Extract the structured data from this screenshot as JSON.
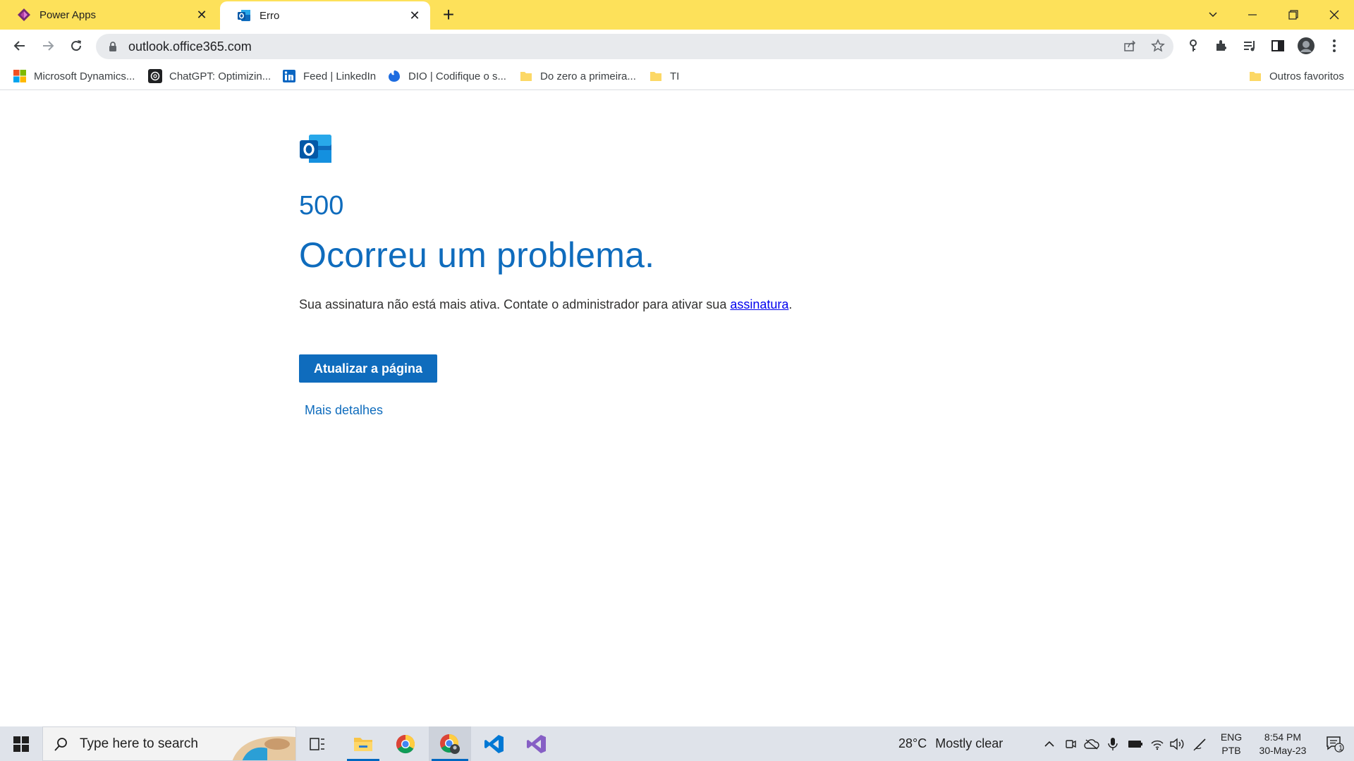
{
  "browser": {
    "tabs": [
      {
        "title": "Power Apps",
        "active": false
      },
      {
        "title": "Erro",
        "active": true
      }
    ],
    "url": "outlook.office365.com"
  },
  "bookmarks": [
    {
      "label": "Microsoft Dynamics...",
      "icon": "microsoft-icon"
    },
    {
      "label": "ChatGPT: Optimizin...",
      "icon": "chatgpt-icon"
    },
    {
      "label": "Feed | LinkedIn",
      "icon": "linkedin-icon"
    },
    {
      "label": "DIO | Codifique o s...",
      "icon": "dio-icon"
    },
    {
      "label": "Do zero a primeira...",
      "icon": "folder-icon"
    },
    {
      "label": "TI",
      "icon": "folder-icon"
    }
  ],
  "other_bookmarks": "Outros favoritos",
  "error": {
    "code": "500",
    "headline": "Ocorreu um problema.",
    "message_prefix": "Sua assinatura não está mais ativa. Contate o administrador para ativar sua ",
    "message_link": "assinatura",
    "message_suffix": ".",
    "refresh_button": "Atualizar a página",
    "details_link": "Mais detalhes"
  },
  "taskbar": {
    "search_placeholder": "Type here to search",
    "weather_temp": "28°C",
    "weather_text": "Mostly clear",
    "lang_top": "ENG",
    "lang_bottom": "PTB",
    "time": "8:54 PM",
    "date": "30-May-23",
    "notification_count": "1"
  },
  "colors": {
    "tabstrip": "#fde15a",
    "accent": "#0f6cbd",
    "taskbar": "#dfe3ea"
  }
}
